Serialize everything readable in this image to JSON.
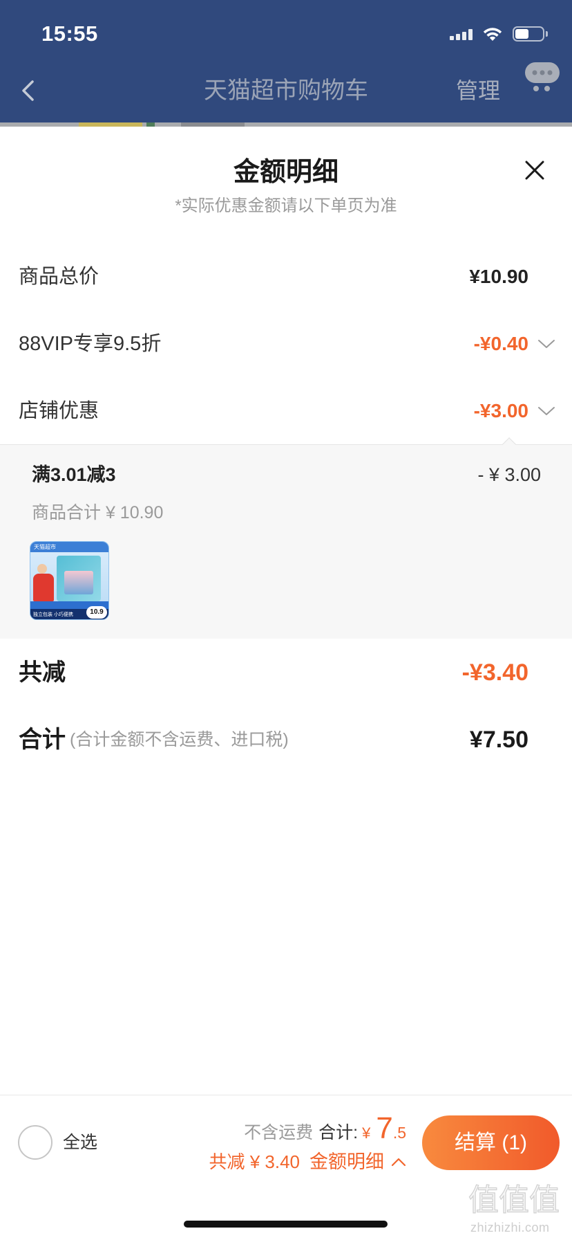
{
  "status_bar": {
    "time": "15:55",
    "battery_level": 0.5,
    "icons": [
      "signal-icon",
      "wifi-icon",
      "battery-icon"
    ]
  },
  "header": {
    "title": "天猫超市购物车",
    "manage": "管理",
    "icons": {
      "back": "chevron-left-icon",
      "chat": "chat-bubble-icon"
    }
  },
  "sheet": {
    "title": "金额明细",
    "subtitle": "*实际优惠金额请以下单页为准",
    "close_icon": "close-icon",
    "rows": [
      {
        "label": "商品总价",
        "value": "¥10.90"
      },
      {
        "label": "88VIP专享9.5折",
        "value": "-¥0.40",
        "icon": "chevron-down-icon"
      },
      {
        "label": "店铺优惠",
        "value": "-¥3.00",
        "icon": "chevron-down-icon"
      }
    ],
    "store_promo": {
      "title": "满3.01减3",
      "amount": "- ¥ 3.00",
      "subtotal": "商品合计 ¥ 10.90",
      "product_thumb": {
        "brand": "天猫超市",
        "tagline": "独立包装 小巧便携",
        "price": "10.9"
      }
    },
    "total_discount": {
      "label": "共减",
      "value": "-¥3.40"
    },
    "total": {
      "label": "合计",
      "note": "(合计金额不含运费、进口税)",
      "value": "¥7.50"
    }
  },
  "bottom_bar": {
    "select_all": "全选",
    "shipping_note": "不含运费",
    "total_label": "合计:",
    "currency": "¥",
    "total_integer": "7",
    "total_decimal": ".5",
    "discount": "共减 ¥ 3.40",
    "detail_link": "金额明细",
    "detail_icon": "chevron-up-icon",
    "checkout": "结算 (1)"
  },
  "watermark": {
    "mark": "值值值",
    "site": "zhizhizhi.com"
  },
  "colors": {
    "header_bg": "#30497d",
    "accent_orange": "#f2652c",
    "button_gradient": [
      "#f88a3e",
      "#f15a2b"
    ],
    "panel_bg": "#f7f7f7"
  }
}
